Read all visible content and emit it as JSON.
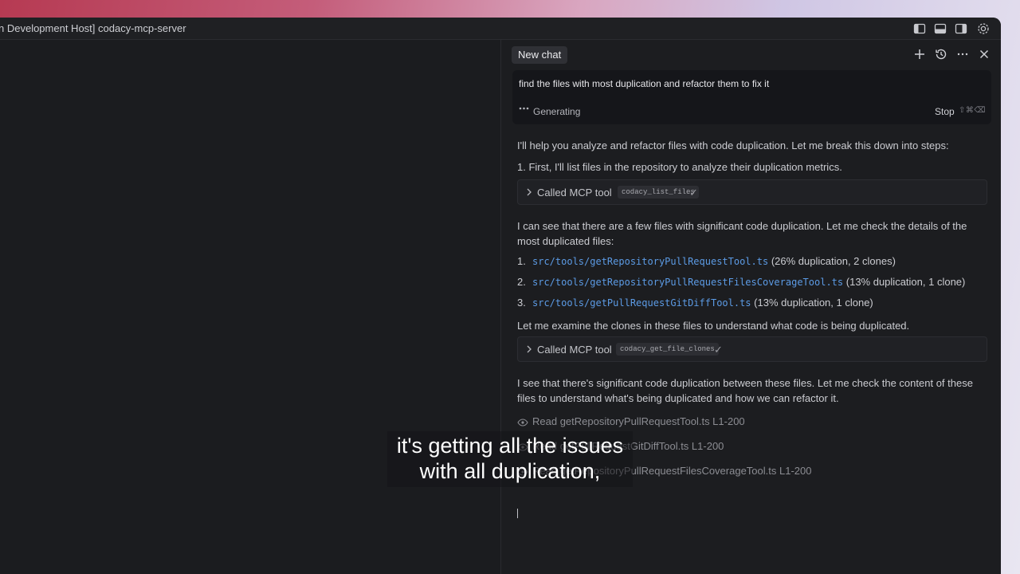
{
  "window": {
    "title": "n Development Host] codacy-mcp-server",
    "toolbar_icons": [
      "toggle-primary-sidebar-icon",
      "toggle-panel-icon",
      "toggle-secondary-sidebar-icon",
      "gear-icon"
    ]
  },
  "chat": {
    "tab_label": "New chat",
    "header_icons": [
      "plus-icon",
      "history-icon",
      "more-icon",
      "close-icon"
    ],
    "prompt": "find the files with most duplication and refactor them to fix it",
    "status": "Generating",
    "stop_label": "Stop",
    "stop_shortcut": "⇧⌘⌫",
    "messages": {
      "intro": "I'll help you analyze and refactor files with code duplication. Let me break this down into steps:",
      "step1": "1. First, I'll list files in the repository to analyze their duplication metrics.",
      "tool1": {
        "label": "Called MCP tool",
        "name": "codacy_list_files",
        "check": "✓"
      },
      "found": "I can see that there are a few files with significant code duplication. Let me check the details of the most duplicated files:",
      "files": [
        {
          "num": "1.",
          "path": "src/tools/getRepositoryPullRequestTool.ts",
          "note": "(26% duplication, 2 clones)"
        },
        {
          "num": "2.",
          "path": "src/tools/getRepositoryPullRequestFilesCoverageTool.ts",
          "note": "(13% duplication, 1 clone)"
        },
        {
          "num": "3.",
          "path": "src/tools/getPullRequestGitDiffTool.ts",
          "note": "(13% duplication, 1 clone)"
        }
      ],
      "examine": "Let me examine the clones in these files to understand what code is being duplicated.",
      "tool2": {
        "label": "Called MCP tool",
        "name": "codacy_get_file_clones",
        "check": "✓"
      },
      "significant": "I see that there's significant code duplication between these files. Let me check the content of these files to understand what's being duplicated and how we can refactor it.",
      "reads": [
        "Read getRepositoryPullRequestTool.ts L1-200",
        "Read getPullRequestGitDiffTool.ts L1-200",
        "Read getRepositoryPullRequestFilesCoverageTool.ts L1-200"
      ]
    }
  },
  "subtitle": {
    "line1": "it's getting all the issues",
    "line2": "with all duplication,"
  }
}
